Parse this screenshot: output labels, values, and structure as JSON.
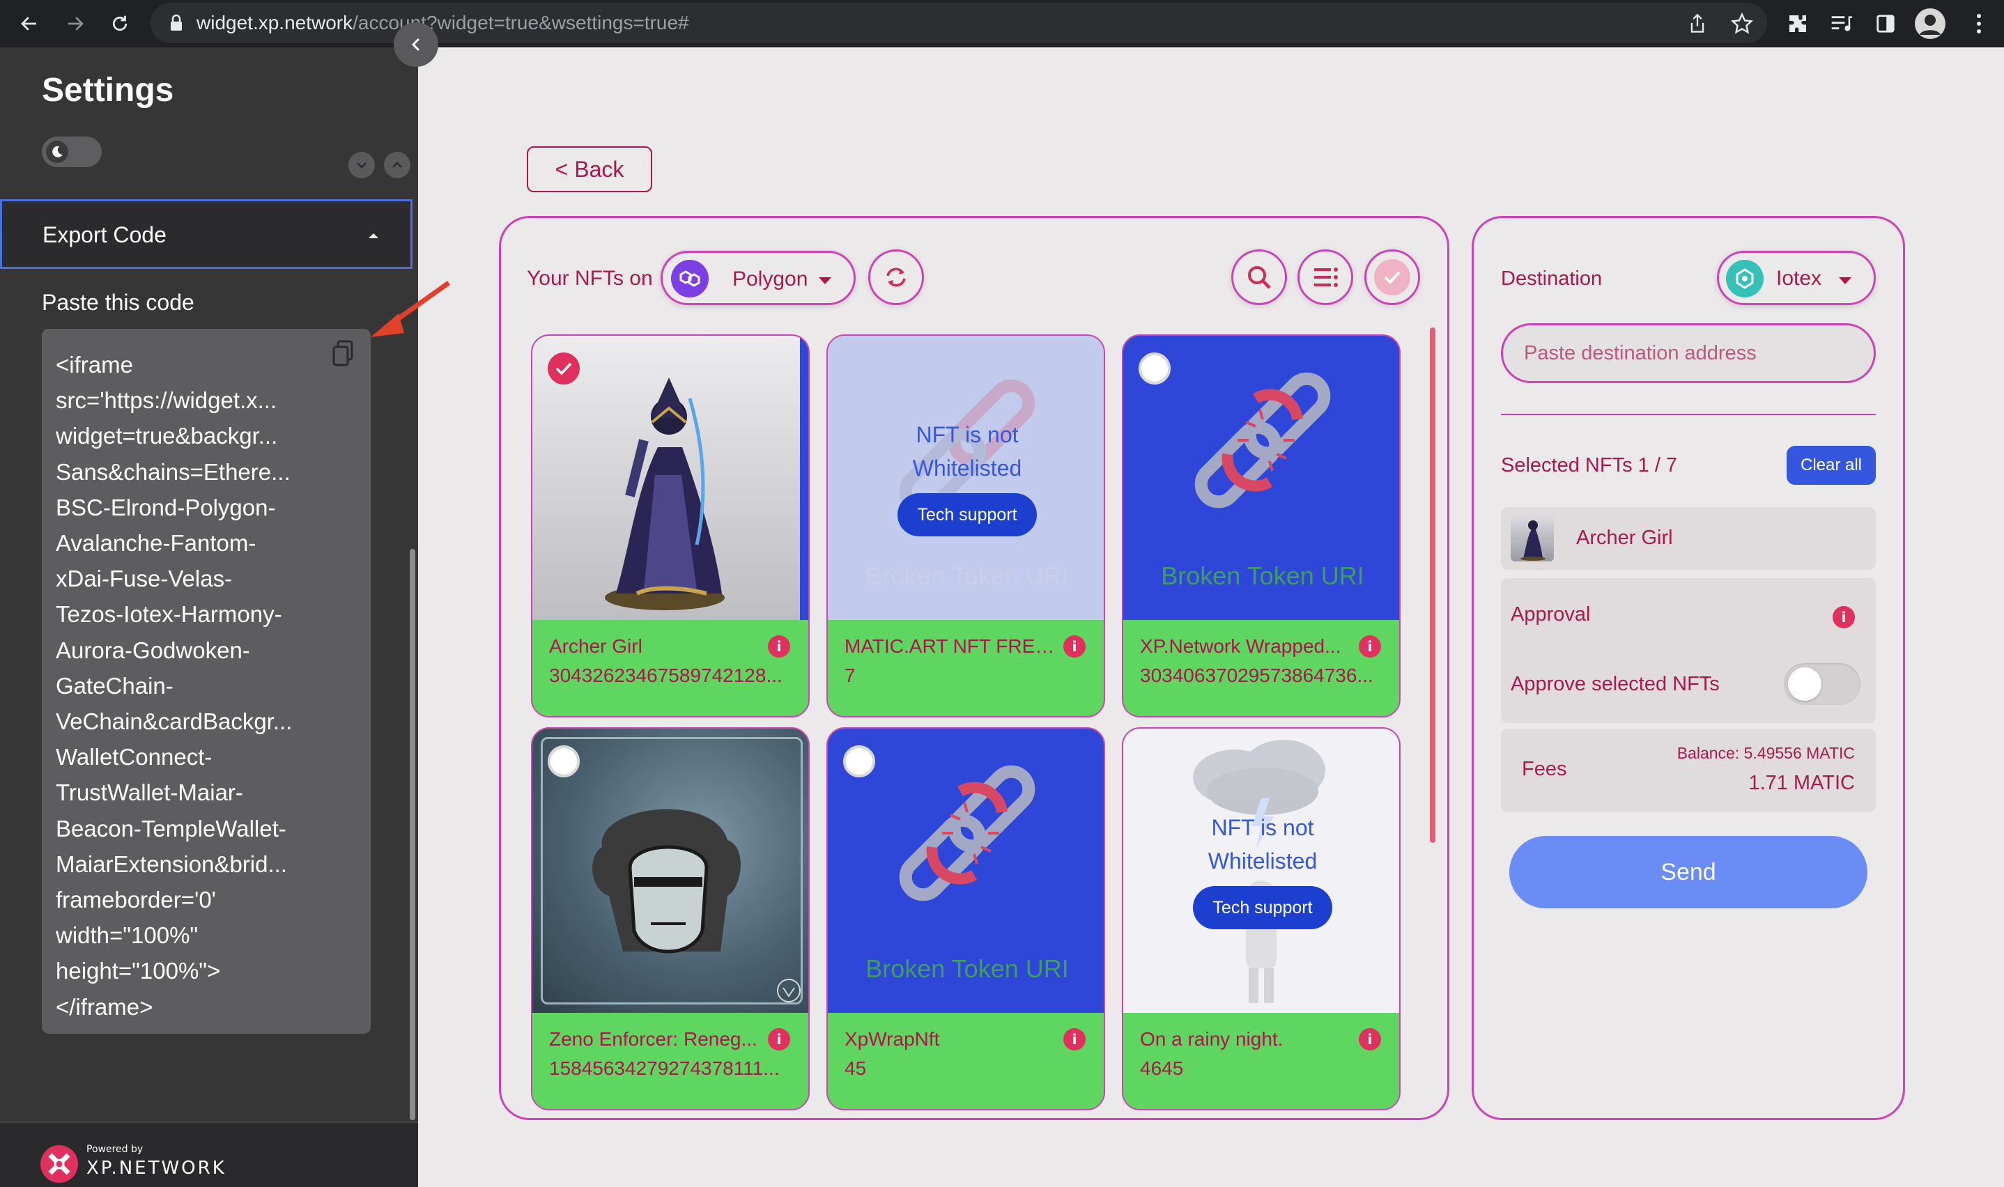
{
  "browser": {
    "url_host": "widget.xp.network",
    "url_path": "/account?widget=true&wsettings=true#"
  },
  "sidebar": {
    "title": "Settings",
    "section_title": "Export Code",
    "paste_label": "Paste this code",
    "code_lines": [
      "<iframe",
      "src='https://widget.x...",
      "widget=true&backgr...",
      "Sans&chains=Ethere...",
      "BSC-Elrond-Polygon-",
      "Avalanche-Fantom-",
      "xDai-Fuse-Velas-",
      "Tezos-Iotex-Harmony-",
      "Aurora-Godwoken-",
      "GateChain-",
      "VeChain&cardBackgr...",
      "WalletConnect-",
      "TrustWallet-Maiar-",
      "Beacon-TempleWallet-",
      "MaiarExtension&brid...",
      "frameborder='0'",
      "width=\"100%\"",
      "height=\"100%\">",
      "</iframe>"
    ],
    "footer_powered": "Powered by",
    "footer_brand": "XP.NETWORK"
  },
  "main": {
    "back_label": "< Back",
    "your_nfts_label": "Your NFTs on",
    "source_chain": "Polygon",
    "nfts": [
      {
        "name": "Archer Girl",
        "token_id": "30432623467589742128...",
        "selected": true
      },
      {
        "name": "MATIC.ART NFT FREE ...",
        "token_id": "7",
        "selected": false,
        "overlay_line1": "NFT is not",
        "overlay_line2": "Whitelisted",
        "tech_support": "Tech support",
        "broken_label": "Broken Token URI"
      },
      {
        "name": "XP.Network Wrapped...",
        "token_id": "30340637029573864736...",
        "selected": false,
        "broken_label": "Broken Token URI"
      },
      {
        "name": "Zeno Enforcer: Reneg...",
        "token_id": "15845634279274378111...",
        "selected": false
      },
      {
        "name": "XpWrapNft",
        "token_id": "45",
        "selected": false,
        "broken_label": "Broken Token URI"
      },
      {
        "name": "On a rainy night.",
        "token_id": "4645",
        "selected": false,
        "overlay_line1": "NFT is not",
        "overlay_line2": "Whitelisted",
        "tech_support": "Tech support"
      }
    ]
  },
  "destination": {
    "label": "Destination",
    "chain": "Iotex",
    "address_placeholder": "Paste destination address",
    "selected_label": "Selected NFTs 1 / 7",
    "clear_label": "Clear all",
    "selected_item": "Archer Girl",
    "approval_label": "Approval",
    "approve_selected_label": "Approve selected NFTs",
    "approve_toggle_on": false,
    "fees_label": "Fees",
    "balance_label": "Balance: 5.49556 MATIC",
    "fees_value": "1.71 MATIC",
    "send_label": "Send"
  },
  "colors": {
    "accent": "#cf42b7",
    "text_accent": "#a8194f",
    "card_info": "#5fd65f",
    "broken_bg": "#2e47d8",
    "button_blue": "#3557e0",
    "send_bg": "#6a8cf5"
  }
}
